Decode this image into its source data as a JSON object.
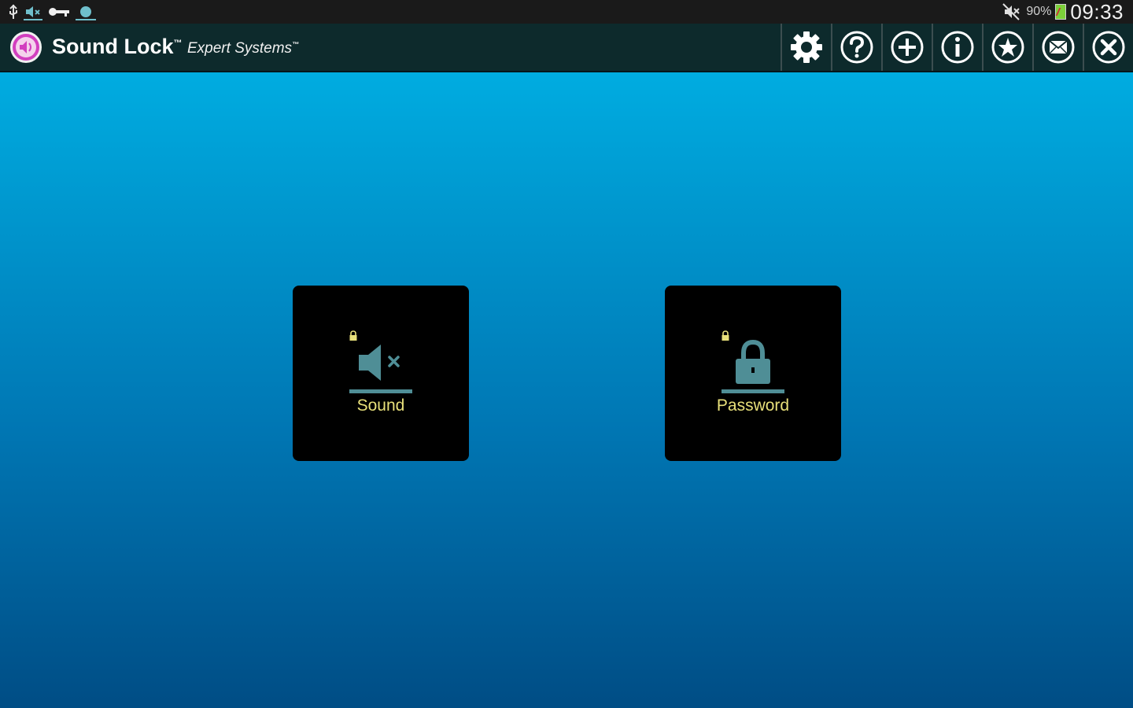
{
  "status_bar": {
    "battery_percent": "90%",
    "time": "09:33",
    "icons": [
      "usb-icon",
      "volume-mute-small-icon",
      "key-icon",
      "notification-dot-icon",
      "mute-icon",
      "battery-icon"
    ]
  },
  "action_bar": {
    "app_name": "Sound Lock",
    "app_name_mark": "™",
    "subtitle": "Expert Systems",
    "subtitle_mark": "™",
    "logo_icon": "sound-lock-logo-icon",
    "buttons": [
      {
        "icon": "gear-icon"
      },
      {
        "icon": "help-icon"
      },
      {
        "icon": "add-icon"
      },
      {
        "icon": "info-icon"
      },
      {
        "icon": "star-icon"
      },
      {
        "icon": "mail-icon"
      },
      {
        "icon": "close-icon"
      }
    ]
  },
  "tiles": [
    {
      "label": "Sound",
      "icon": "speaker-mute-icon",
      "badge_icon": "lock-badge-icon"
    },
    {
      "label": "Password",
      "icon": "padlock-icon",
      "badge_icon": "lock-badge-icon"
    }
  ],
  "colors": {
    "background_top": "#00b7ea",
    "background_bottom": "#004d85",
    "action_bar": "#0d2a2c",
    "tile_bg": "#000000",
    "tile_label": "#e8e07a",
    "tile_icon": "#4f8e96",
    "logo": "#d23fbf"
  }
}
